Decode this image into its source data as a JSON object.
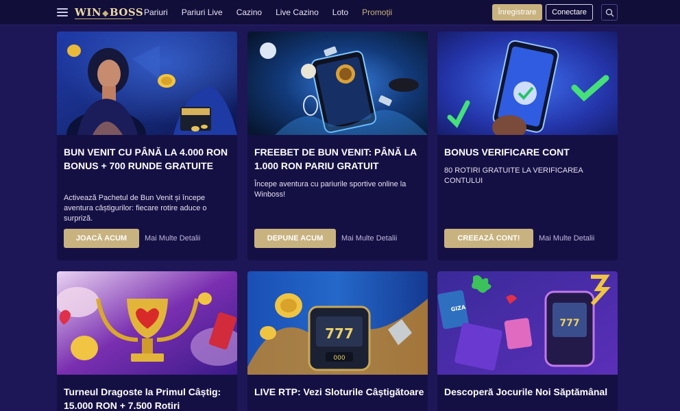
{
  "header": {
    "logo": {
      "left": "WIN",
      "right": "BOSS",
      "diamond": "◆"
    },
    "nav": [
      "Pariuri",
      "Pariuri Live",
      "Cazino",
      "Live Cazino",
      "Loto",
      "Promoții"
    ],
    "register_label": "Înregistrare",
    "login_label": "Conectare"
  },
  "promos": [
    {
      "title": "BUN VENIT CU PÂNĂ LA 4.000 RON BONUS + 700 RUNDE GRATUITE",
      "desc": "Activează Pachetul de Bun Venit și începe aventura câștigurilor: fiecare rotire aduce o surpriză.",
      "cta": "JOACĂ ACUM",
      "more": "Mai Multe Detalii"
    },
    {
      "title": "FREEBET DE BUN VENIT: PÂNĂ LA 1.000 RON PARIU GRATUIT",
      "desc": "Începe aventura cu pariurile sportive online la Winboss!",
      "cta": "DEPUNE ACUM",
      "more": "Mai Multe Detalii"
    },
    {
      "title": "BONUS VERIFICARE CONT",
      "desc": "80 ROTIRI GRATUITE LA VERIFICAREA CONTULUI",
      "cta": "CREEAZĂ CONT!",
      "more": "Mai Multe Detalii"
    },
    {
      "title": "Turneul Dragoste la Primul Câștig: 15.000 RON + 7.500 Rotiri"
    },
    {
      "title": "LIVE RTP: Vezi Sloturile Câștigătoare"
    },
    {
      "title": "Descoperă Jocurile Noi Săptămânal"
    }
  ],
  "image_labels": {
    "giza": "GIZA",
    "slot_reels": "000"
  },
  "colors": {
    "background": "#1d1657",
    "header": "#120e3a",
    "card": "#151044",
    "gold": "#c8b27f"
  }
}
